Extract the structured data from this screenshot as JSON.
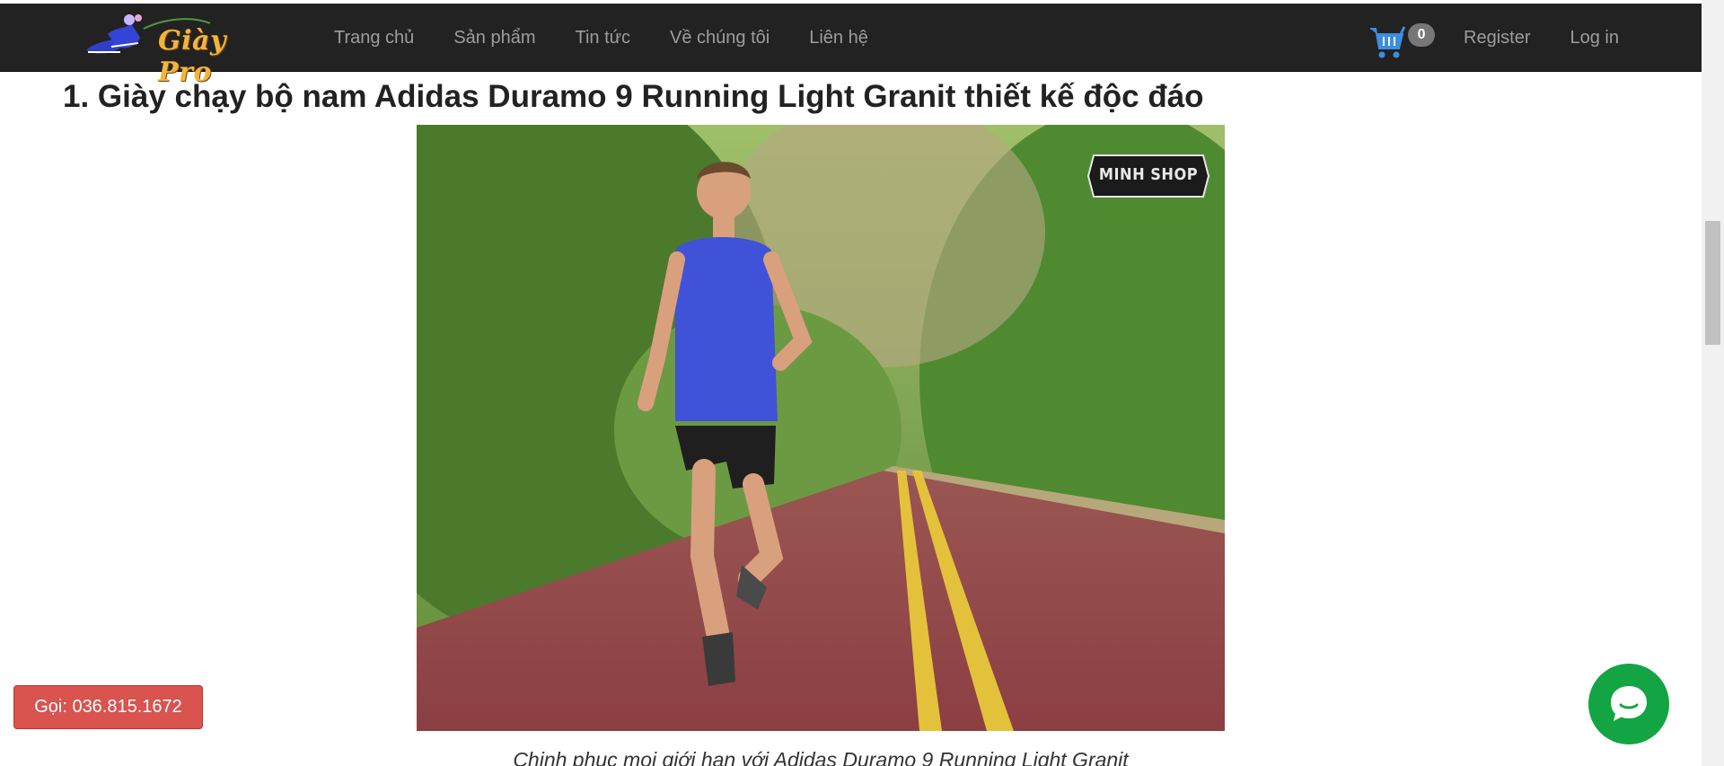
{
  "nav": {
    "brand": "Giày Pro",
    "links": [
      "Trang chủ",
      "Sản phẩm",
      "Tin tức",
      "Về chúng tôi",
      "Liên hệ"
    ],
    "cart_count": "0",
    "register": "Register",
    "login": "Log in"
  },
  "article": {
    "title": "1. Giày chạy bộ nam Adidas Duramo 9 Running Light Granit thiết kế độc đáo",
    "image_watermark": "MINH SHOP",
    "caption": "Chinh phục mọi giới hạn với Adidas Duramo 9 Running Light Granit"
  },
  "floating": {
    "call_label": "Gọi: 036.815.1672",
    "chat_icon": "chat-bubble-icon"
  },
  "icons": {
    "cart": "shopping-cart-icon",
    "logo": "running-shoes-logo"
  },
  "colors": {
    "navbar": "#222222",
    "nav_text": "#9d9d9d",
    "call_button": "#d9534f",
    "chat_button": "#13a444",
    "cart_icon": "#3d8ee0"
  }
}
